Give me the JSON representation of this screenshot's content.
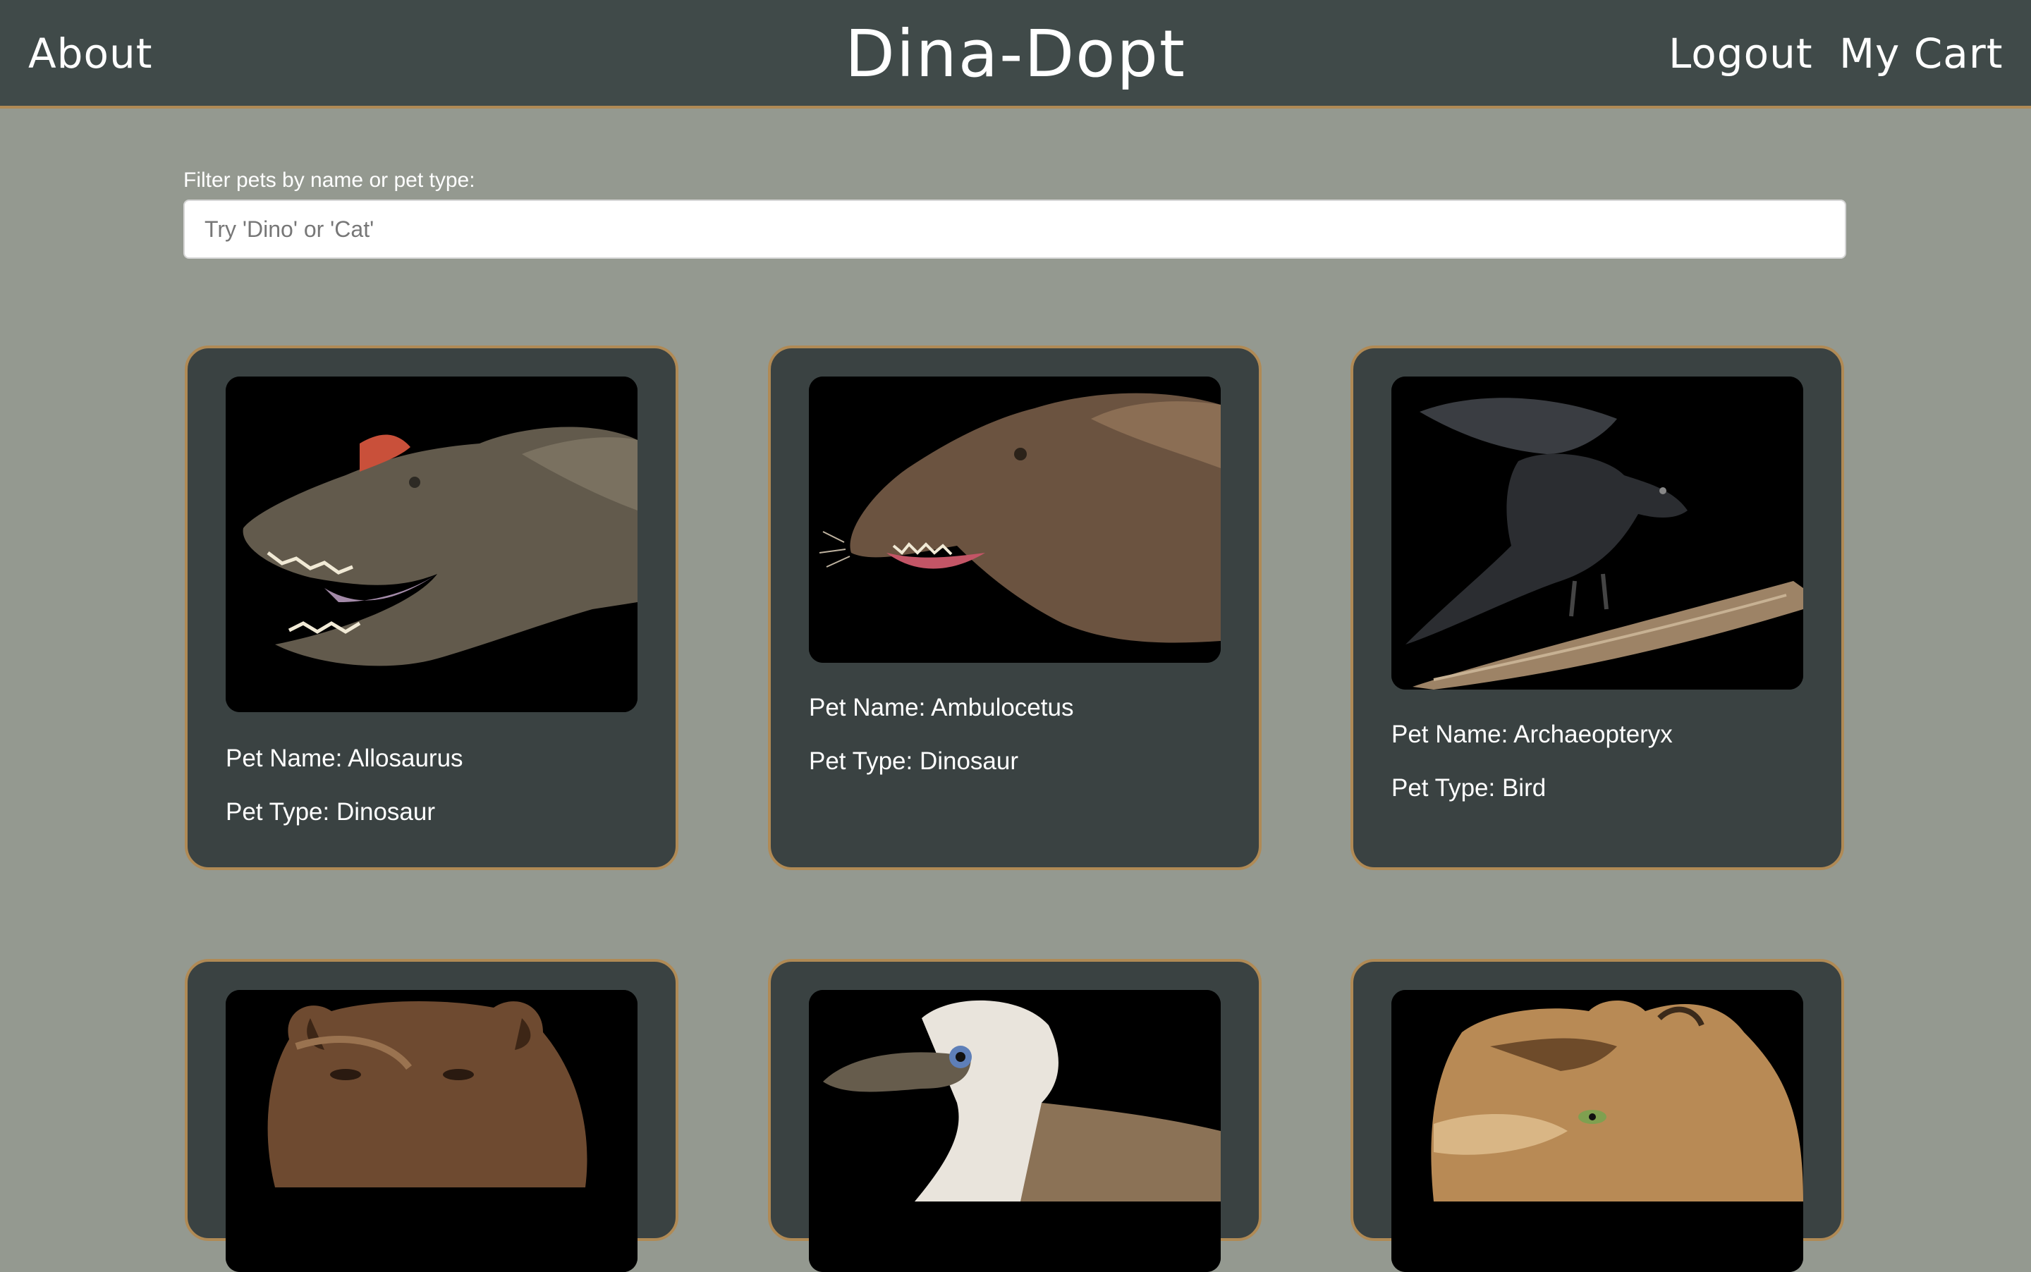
{
  "nav": {
    "about": "About",
    "brand": "Dina-Dopt",
    "logout": "Logout",
    "cart": "My Cart"
  },
  "filter": {
    "label": "Filter pets by name or pet type:",
    "placeholder": "Try 'Dino' or 'Cat'",
    "value": ""
  },
  "pets": [
    {
      "name_line": "Pet Name: Allosaurus",
      "type_line": "Pet Type: Dinosaur",
      "image": "allosaurus-photo"
    },
    {
      "name_line": "Pet Name: Ambulocetus",
      "type_line": "Pet Type: Dinosaur",
      "image": "ambulocetus-photo"
    },
    {
      "name_line": "Pet Name: Archaeopteryx",
      "type_line": "Pet Type: Bird",
      "image": "archaeopteryx-photo"
    },
    {
      "image": "bear-photo"
    },
    {
      "image": "dodo-bird-photo"
    },
    {
      "image": "saber-tooth-cat-photo"
    }
  ],
  "colors": {
    "page_bg": "#949990",
    "navbar_bg": "#404a49",
    "card_bg": "#3a4242",
    "card_border": "#b08a55"
  }
}
